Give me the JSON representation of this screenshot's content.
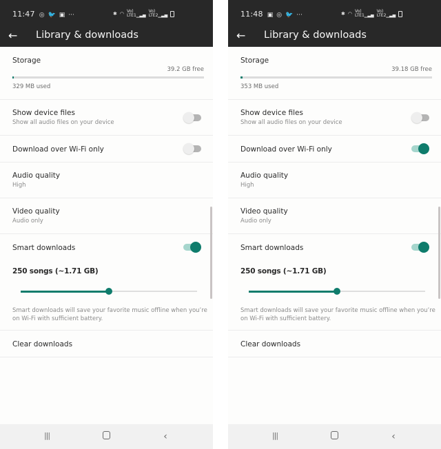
{
  "screens": [
    {
      "status": {
        "time": "11:47",
        "notif_icons": [
          "whatsapp-icon",
          "twitter-icon",
          "gallery-icon",
          "more-icon"
        ],
        "sys_icons": [
          "bluetooth-icon",
          "wifi-icon",
          "volte-lte1-signal-icon",
          "volte-lte2-signal-icon",
          "battery-charging-icon"
        ]
      },
      "header": {
        "title": "Library & downloads",
        "back_label": "←"
      },
      "storage": {
        "label": "Storage",
        "free": "39.2 GB free",
        "used": "329 MB used",
        "used_fraction": 0.008
      },
      "show_device_files": {
        "label": "Show device files",
        "sub": "Show all audio files on your device",
        "on": false
      },
      "download_wifi": {
        "label": "Download over Wi-Fi only",
        "on": false
      },
      "audio_quality": {
        "label": "Audio quality",
        "value": "High"
      },
      "video_quality": {
        "label": "Video quality",
        "value": "Audio only"
      },
      "smart_downloads": {
        "label": "Smart downloads",
        "on": true,
        "count": "250 songs (~1.71 GB)",
        "slider_fraction": 0.5,
        "desc": "Smart downloads will save your favorite music offline when you’re on Wi-Fi with sufficient battery."
      },
      "clear_downloads": {
        "label": "Clear downloads"
      },
      "nav": {
        "recent": "|||",
        "home": "",
        "back": "‹"
      }
    },
    {
      "status": {
        "time": "11:48",
        "notif_icons": [
          "gallery-icon",
          "whatsapp-icon",
          "twitter-icon",
          "more-icon"
        ],
        "sys_icons": [
          "bluetooth-icon",
          "wifi-icon",
          "volte-lte1-signal-icon",
          "volte-lte2-signal-icon",
          "battery-charging-icon"
        ]
      },
      "header": {
        "title": "Library & downloads",
        "back_label": "←"
      },
      "storage": {
        "label": "Storage",
        "free": "39.18 GB free",
        "used": "353 MB used",
        "used_fraction": 0.009
      },
      "show_device_files": {
        "label": "Show device files",
        "sub": "Show all audio files on your device",
        "on": false
      },
      "download_wifi": {
        "label": "Download over Wi-Fi only",
        "on": true
      },
      "audio_quality": {
        "label": "Audio quality",
        "value": "High"
      },
      "video_quality": {
        "label": "Video quality",
        "value": "Audio only"
      },
      "smart_downloads": {
        "label": "Smart downloads",
        "on": true,
        "count": "250 songs (~1.71 GB)",
        "slider_fraction": 0.5,
        "desc": "Smart downloads will save your favorite music offline when you’re on Wi-Fi with sufficient battery."
      },
      "clear_downloads": {
        "label": "Clear downloads"
      },
      "nav": {
        "recent": "|||",
        "home": "",
        "back": "‹"
      }
    }
  ],
  "icon_glyphs": {
    "whatsapp-icon": "◎",
    "twitter-icon": "🐦",
    "gallery-icon": "▣",
    "more-icon": "···",
    "bluetooth-icon": "✱",
    "wifi-icon": "◠"
  },
  "accent_color": "#0f7c6c"
}
